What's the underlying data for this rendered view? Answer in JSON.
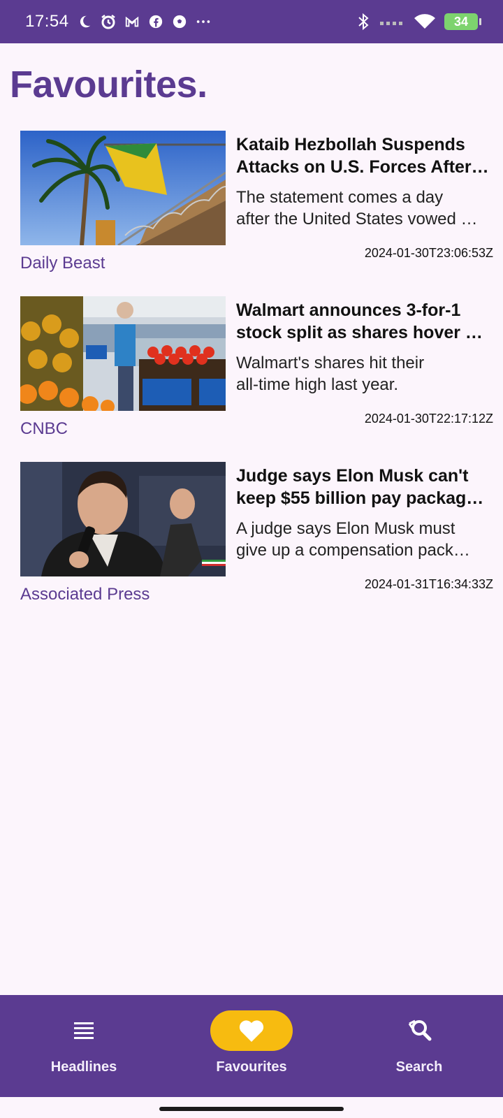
{
  "status_bar": {
    "time": "17:54",
    "battery": "34"
  },
  "page": {
    "title": "Favourites."
  },
  "articles": [
    {
      "headline_line1": "Kataib Hezbollah Suspends",
      "headline_line2": "Attacks on U.S. Forces After…",
      "desc_line1": "The statement comes a day",
      "desc_line2": "after the United States vowed …",
      "source": "Daily Beast",
      "date": "2024-01-30T23:06:53Z"
    },
    {
      "headline_line1": "Walmart announces 3-for-1",
      "headline_line2": "stock split as shares hover …",
      "desc_line1": "Walmart's shares hit their",
      "desc_line2": "all-time high last year.",
      "source": "CNBC",
      "date": "2024-01-30T22:17:12Z"
    },
    {
      "headline_line1": "Judge says Elon Musk can't",
      "headline_line2": "keep $55 billion pay packag…",
      "desc_line1": "A judge says Elon Musk must",
      "desc_line2": "give up a compensation pack…",
      "source": "Associated Press",
      "date": "2024-01-31T16:34:33Z"
    }
  ],
  "bottom_nav": {
    "items": [
      {
        "label": "Headlines",
        "icon": "list-icon",
        "active": false
      },
      {
        "label": "Favourites",
        "icon": "heart-icon",
        "active": true
      },
      {
        "label": "Search",
        "icon": "search-icon",
        "active": false
      }
    ]
  },
  "colors": {
    "primary": "#5b3b91",
    "accent": "#f7bb10",
    "background": "#fcf5fc"
  }
}
